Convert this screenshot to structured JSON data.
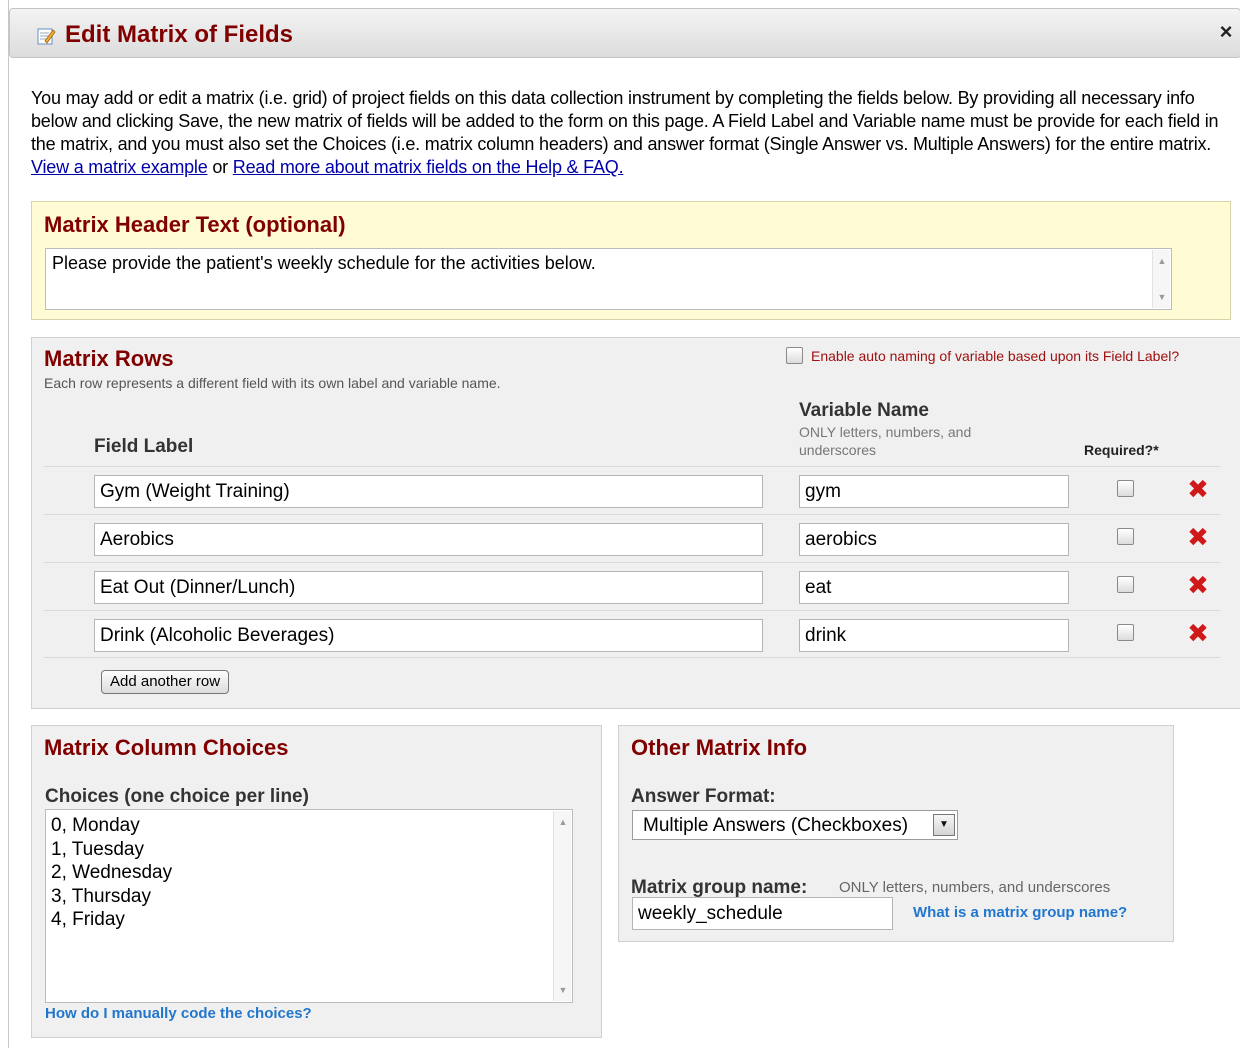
{
  "dialog": {
    "title": "Edit Matrix of Fields",
    "close_glyph": "×"
  },
  "intro": {
    "text": "You may add or edit a matrix (i.e. grid) of project fields on this data collection instrument by completing the fields below. By providing all necessary info below and clicking Save, the new matrix of fields will be added to the form on this page. A Field Label and Variable name must be provide for each field in the matrix, and you must also set the Choices (i.e. matrix column headers) and answer format (Single Answer vs. Multiple Answers) for the entire matrix.",
    "link_example": "View a matrix example",
    "or_text": "or",
    "link_help": "Read more about matrix fields on the Help & FAQ."
  },
  "header_section": {
    "title": "Matrix Header Text (optional)",
    "value": "Please provide the patient's weekly schedule for the activities below."
  },
  "rows_section": {
    "title": "Matrix Rows",
    "subtitle": "Each row represents a different field with its own label and variable name.",
    "auto_naming_label": "Enable auto naming of variable based upon its Field Label?",
    "col_field_label": "Field Label",
    "col_variable_name": "Variable Name",
    "col_variable_hint": "ONLY letters, numbers, and underscores",
    "col_required": "Required?*",
    "rows": [
      {
        "label": "Gym (Weight Training)",
        "variable": "gym"
      },
      {
        "label": "Aerobics",
        "variable": "aerobics"
      },
      {
        "label": "Eat Out (Dinner/Lunch)",
        "variable": "eat"
      },
      {
        "label": "Drink (Alcoholic Beverages)",
        "variable": "drink"
      }
    ],
    "delete_glyph": "✖",
    "add_row_label": "Add another row"
  },
  "choices_section": {
    "title": "Matrix Column Choices",
    "label": "Choices (one choice per line)",
    "choices": [
      "0, Monday",
      "1, Tuesday",
      "2, Wednesday",
      "3, Thursday",
      "4, Friday"
    ],
    "help_link": "How do I manually code the choices?"
  },
  "other_section": {
    "title": "Other Matrix Info",
    "answer_format_label": "Answer Format:",
    "answer_format_value": "Multiple Answers (Checkboxes)",
    "group_name_label": "Matrix group name:",
    "group_name_hint": "ONLY letters, numbers, and underscores",
    "group_name_value": "weekly_schedule",
    "help_link": "What is a matrix group name?"
  },
  "colors": {
    "section_title": "#800000",
    "header_bg": "#fffbd4",
    "panel_bg": "#f0f0f0",
    "delete": "#d01818",
    "link": "#2277cc"
  },
  "icons": {
    "title": "edit-form-icon",
    "close": "close-icon",
    "delete": "delete-x-icon",
    "select_arrow": "chevron-down-icon"
  }
}
